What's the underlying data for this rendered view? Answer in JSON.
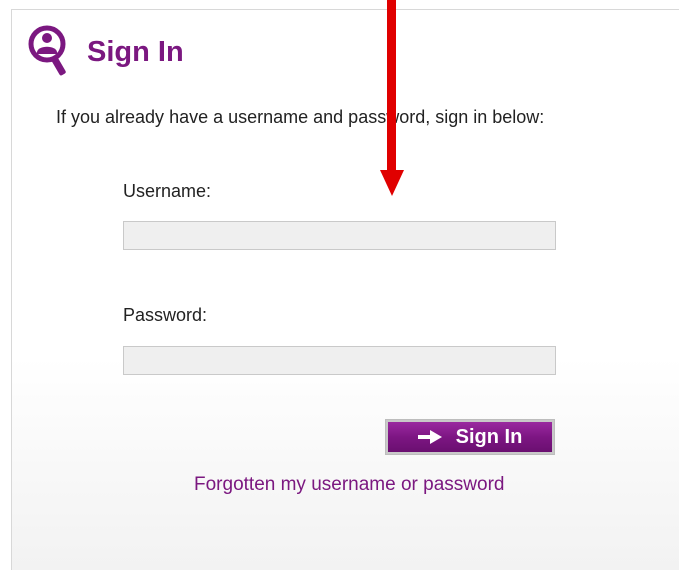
{
  "header": {
    "title": "Sign In",
    "icon": "user-magnifier-icon"
  },
  "intro_text": "If you already have a username and password, sign in below:",
  "form": {
    "username_label": "Username:",
    "username_value": "",
    "password_label": "Password:",
    "password_value": "",
    "submit_label": "Sign In",
    "submit_icon": "arrow-right-icon",
    "forgot_link": "Forgotten my username or password"
  },
  "annotation": {
    "icon": "red-arrow-down-icon",
    "color": "#e00000"
  },
  "colors": {
    "brand_purple": "#7b1880",
    "field_background": "#efefef",
    "text": "#222222"
  }
}
